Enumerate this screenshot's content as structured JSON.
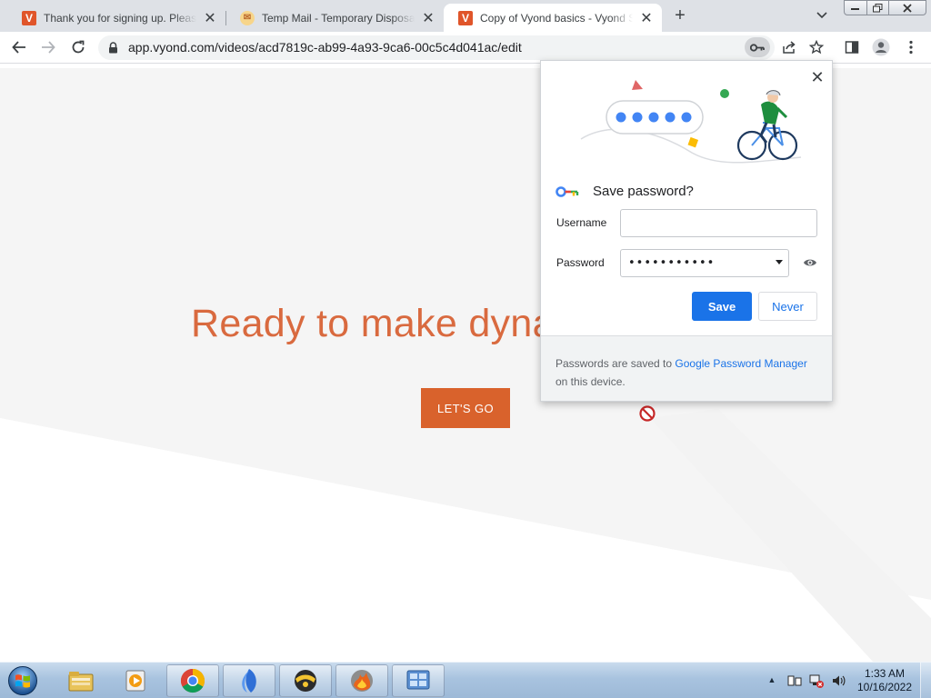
{
  "browser": {
    "tabs": [
      {
        "title": "Thank you for signing up. Please",
        "favicon": "vyond-icon"
      },
      {
        "title": "Temp Mail - Temporary Disposab",
        "favicon": "temp-mail-icon"
      },
      {
        "title": "Copy of Vyond basics - Vyond St",
        "favicon": "vyond-icon",
        "active": true
      }
    ],
    "favicon_letter": "V",
    "new_tab_label": "+",
    "close_glyph": "✕",
    "url": "app.vyond.com/videos/acd7819c-ab99-4a93-9ca6-00c5c4d041ac/edit"
  },
  "page": {
    "headline": "Ready to make dyna",
    "cta_label": "LET'S GO"
  },
  "password_bubble": {
    "title": "Save password?",
    "username_label": "Username",
    "username_value": "",
    "password_label": "Password",
    "password_masked": "•••••••••••",
    "save_label": "Save",
    "never_label": "Never",
    "footer_prefix": "Passwords are saved to ",
    "footer_link": "Google Password Manager",
    "footer_suffix": " on this device.",
    "close_glyph": "✕"
  },
  "taskbar": {
    "items": [
      "file-explorer-icon",
      "media-player-icon",
      "chrome-icon",
      "feather-app-icon",
      "driver-app-icon",
      "fire-globe-icon",
      "control-panel-icon"
    ],
    "clock_time": "1:33 AM",
    "clock_date": "10/16/2022",
    "tray_arrow": "▲"
  },
  "colors": {
    "accent_orange": "#d9622c",
    "headline_orange": "#d96a3f",
    "chrome_blue": "#1a73e8",
    "tabstrip": "#dee1e6"
  }
}
